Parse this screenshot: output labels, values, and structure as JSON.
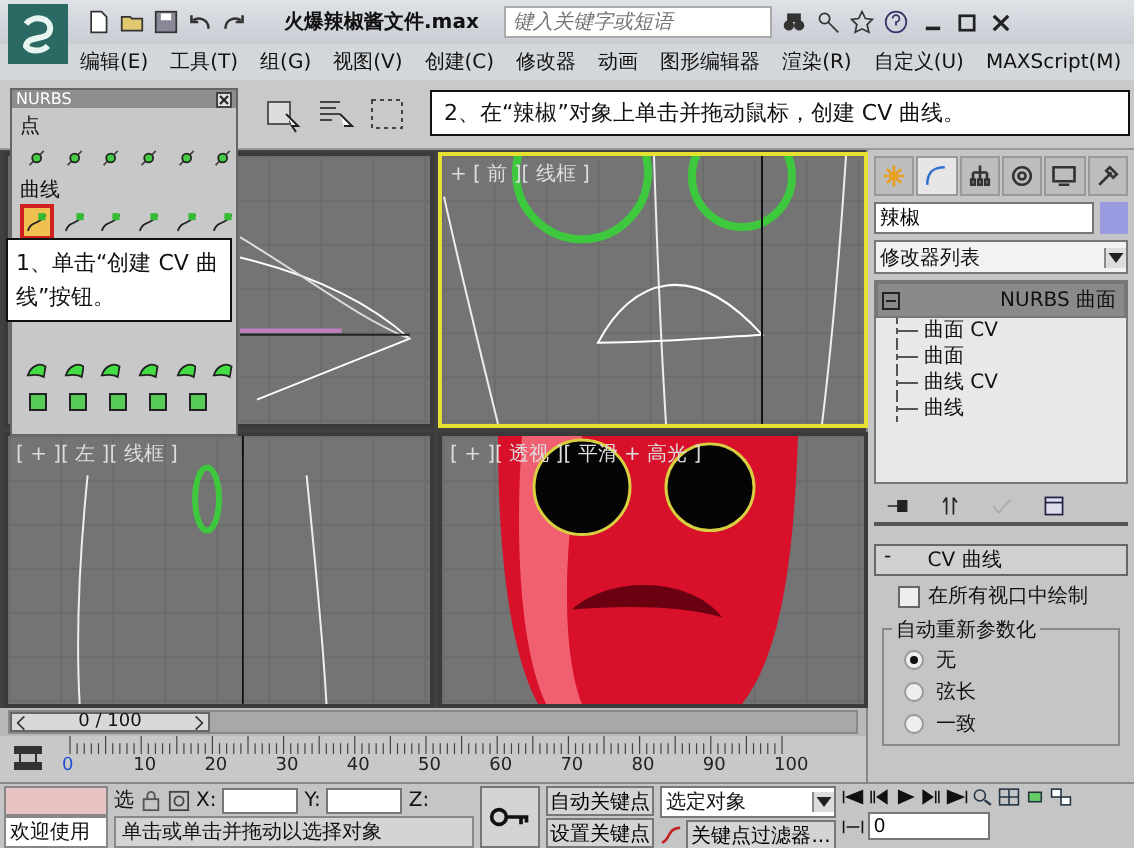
{
  "window": {
    "title": "火爆辣椒酱文件.max",
    "search": {
      "placeholder": "键入关键字或短语"
    }
  },
  "menu": [
    "编辑(E)",
    "工具(T)",
    "组(G)",
    "视图(V)",
    "创建(C)",
    "修改器",
    "动画",
    "图形编辑器",
    "渲染(R)",
    "自定义(U)",
    "MAXScript(M)"
  ],
  "nurbs_panel": {
    "title": "NURBS",
    "sections": [
      {
        "label": "点",
        "kind": "point"
      },
      {
        "label": "曲线",
        "kind": "curve"
      },
      {
        "kind": "surface"
      }
    ],
    "cv_curve_tool": {
      "highlighted": true
    }
  },
  "callouts": [
    {
      "text": "2、在“辣椒”对象上单击并拖动鼠标，创建 CV 曲线。"
    },
    {
      "text": "1、单击“创建 CV 曲线”按钮。"
    }
  ],
  "viewports": [
    {
      "kind": "top",
      "selected": false
    },
    {
      "kind": "front",
      "label": "+ [ 前 ][ 线框 ]",
      "selected": true
    },
    {
      "kind": "left",
      "label": "[ + ][ 左 ][ 线框 ]",
      "selected": false
    },
    {
      "kind": "perspective",
      "label": "[ + ][ 透视 ][ 平滑 + 高光 ]",
      "selected": false
    }
  ],
  "command_panel": {
    "tabs": [
      {
        "kind": "create",
        "selected": false
      },
      {
        "kind": "modify",
        "selected": true
      },
      {
        "kind": "hierarchy",
        "selected": false
      },
      {
        "kind": "motion",
        "selected": false
      },
      {
        "kind": "display",
        "selected": false
      },
      {
        "kind": "utilities",
        "selected": false
      }
    ],
    "object_name": "辣椒",
    "modifier_list": "修改器列表",
    "stack": {
      "label": "NURBS 曲面",
      "expanded": true,
      "selected": true,
      "children": [
        {
          "label": "曲面 CV"
        },
        {
          "label": "曲面"
        },
        {
          "label": "曲线 CV"
        },
        {
          "label": "曲线"
        }
      ]
    },
    "rollout": {
      "sign": "-",
      "title": "CV 曲线",
      "draw_all": {
        "label": "在所有视口中绘制",
        "checked": false
      },
      "reparam": {
        "title": "自动重新参数化",
        "options": [
          {
            "label": "无",
            "selected": true
          },
          {
            "label": "弦长",
            "selected": false
          },
          {
            "label": "一致",
            "selected": false
          }
        ]
      }
    }
  },
  "timeline": {
    "slider_label": "0 / 100",
    "level": 0,
    "ticks": [
      "0",
      "10",
      "20",
      "30",
      "40",
      "50",
      "60",
      "70",
      "80",
      "90",
      "100"
    ]
  },
  "status": {
    "welcome": "欢迎使用",
    "lock_label": "选",
    "x_label": "X:",
    "y_label": "Y:",
    "z_label": "Z:",
    "prompt": "单击或单击并拖动以选择对象",
    "auto_key": "自动关键点",
    "set_key": "设置关键点",
    "key_mode": "选定对象",
    "key_filters": "关键点过滤器...",
    "frame": "0"
  }
}
